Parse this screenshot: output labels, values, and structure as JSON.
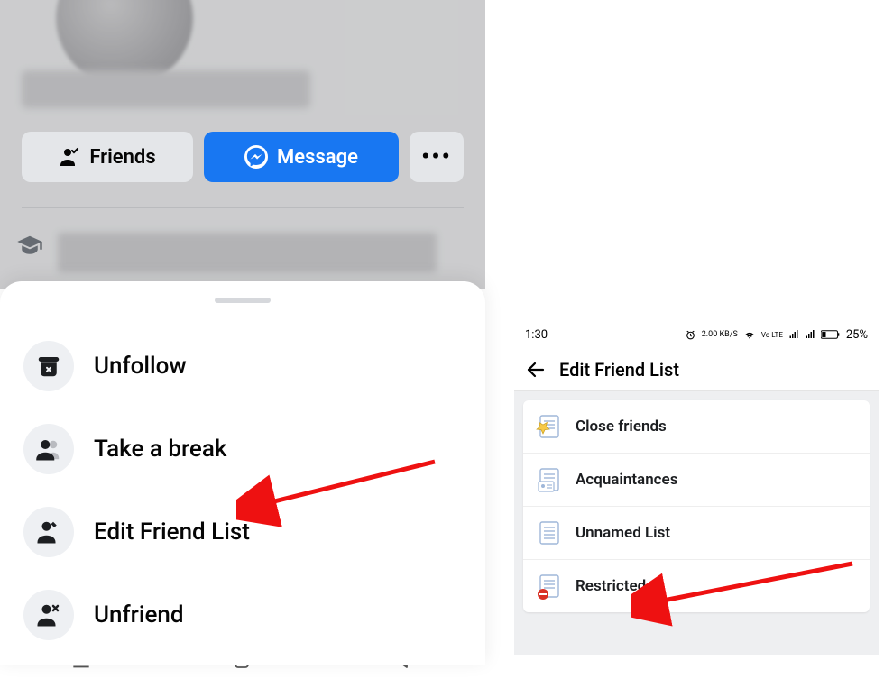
{
  "left": {
    "profile": {
      "buttons": {
        "friends": "Friends",
        "message": "Message",
        "more": "•••"
      }
    },
    "sheet": {
      "options": [
        {
          "icon": "archive-x-icon",
          "label": "Unfollow"
        },
        {
          "icon": "people-icon",
          "label": "Take a break"
        },
        {
          "icon": "person-edit-icon",
          "label": "Edit Friend List"
        },
        {
          "icon": "person-remove-icon",
          "label": "Unfriend"
        }
      ]
    }
  },
  "right": {
    "status": {
      "time": "1:30",
      "net_speed": "2.00 KB/S",
      "lte_label": "Vo LTE",
      "battery_pct": "25%"
    },
    "header": {
      "title": "Edit Friend List"
    },
    "list": [
      {
        "icon": "doc-star-icon",
        "label": "Close friends"
      },
      {
        "icon": "doc-card-icon",
        "label": "Acquaintances"
      },
      {
        "icon": "doc-icon",
        "label": "Unnamed List"
      },
      {
        "icon": "doc-block-icon",
        "label": "Restricted"
      }
    ]
  }
}
